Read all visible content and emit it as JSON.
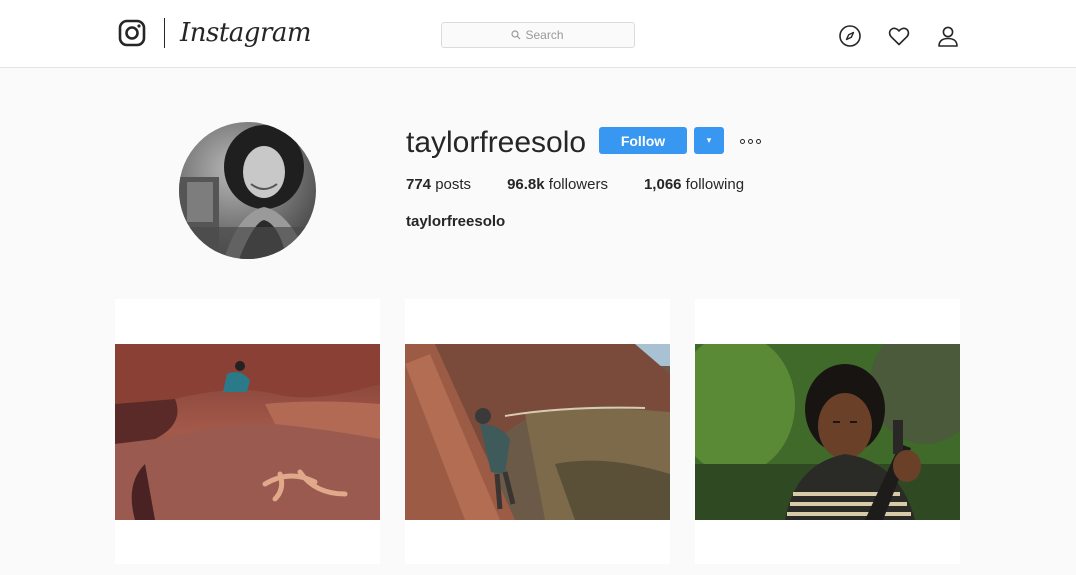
{
  "header": {
    "brand": "Instagram",
    "search_placeholder": "Search",
    "icons": [
      "instagram-icon",
      "search-icon",
      "compass-icon",
      "heart-icon",
      "user-icon"
    ]
  },
  "profile": {
    "username": "taylorfreesolo",
    "follow_label": "Follow",
    "dropdown_label": "▾",
    "posts_count": "774",
    "posts_label": " posts",
    "followers_count": "96.8k",
    "followers_label": " followers",
    "following_count": "1,066",
    "following_label": " following",
    "full_name": "taylorfreesolo"
  },
  "colors": {
    "accent": "#3897f0",
    "background": "#fafafa",
    "text": "#262626"
  }
}
